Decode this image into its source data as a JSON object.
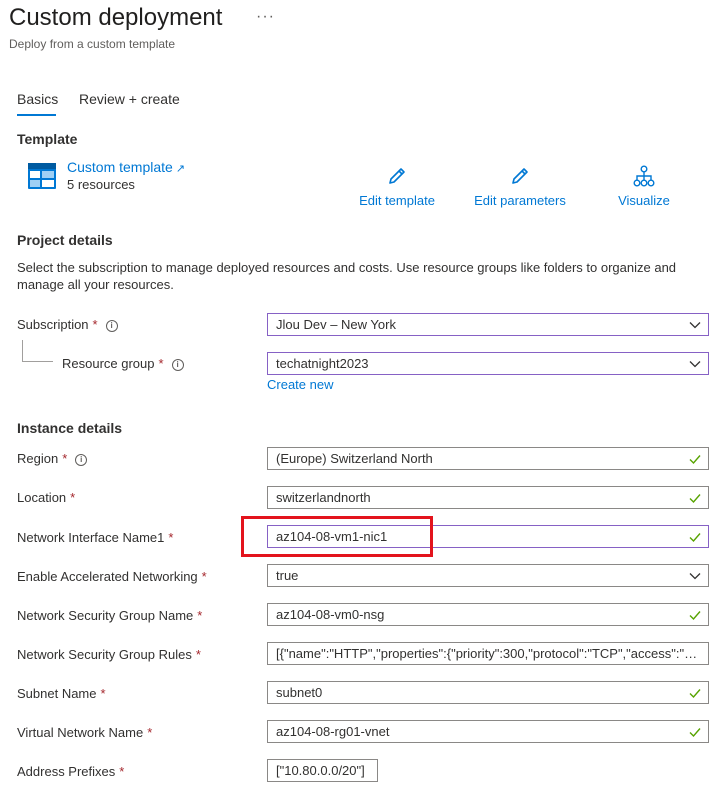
{
  "header": {
    "title": "Custom deployment",
    "subtitle": "Deploy from a custom template",
    "more": "···"
  },
  "tabs": [
    {
      "label": "Basics",
      "active": true
    },
    {
      "label": "Review + create",
      "active": false
    }
  ],
  "template": {
    "heading": "Template",
    "link": "Custom template",
    "count": "5 resources",
    "icon": "template-grid-icon",
    "actions": [
      {
        "label": "Edit template",
        "icon": "pencil-icon"
      },
      {
        "label": "Edit parameters",
        "icon": "pencil-icon"
      },
      {
        "label": "Visualize",
        "icon": "hierarchy-icon"
      }
    ]
  },
  "project": {
    "heading": "Project details",
    "description": "Select the subscription to manage deployed resources and costs. Use resource groups like folders to organize and manage all your resources.",
    "subscription_label": "Subscription",
    "subscription_value": "Jlou Dev – New York",
    "resource_group_label": "Resource group",
    "resource_group_value": "techatnight2023",
    "create_new": "Create new"
  },
  "instance": {
    "heading": "Instance details",
    "fields": [
      {
        "label": "Region",
        "value": "(Europe) Switzerland North"
      },
      {
        "label": "Location",
        "value": "switzerlandnorth"
      },
      {
        "label": "Network Interface Name1",
        "value": "az104-08-vm1-nic1"
      },
      {
        "label": "Enable Accelerated Networking",
        "value": "true"
      },
      {
        "label": "Network Security Group Name",
        "value": "az104-08-vm0-nsg"
      },
      {
        "label": "Network Security Group Rules",
        "value": "[{\"name\":\"HTTP\",\"properties\":{\"priority\":300,\"protocol\":\"TCP\",\"access\":\"Al..."
      },
      {
        "label": "Subnet Name",
        "value": "subnet0"
      },
      {
        "label": "Virtual Network Name",
        "value": "az104-08-rg01-vnet"
      },
      {
        "label": "Address Prefixes",
        "value": "[\"10.80.0.0/20\"]"
      }
    ]
  },
  "required_marker": "*",
  "info_marker": "i",
  "colors": {
    "accent": "#0078d4",
    "valid": "#57a300",
    "required": "#a4262c",
    "highlight": "#e3131c"
  }
}
